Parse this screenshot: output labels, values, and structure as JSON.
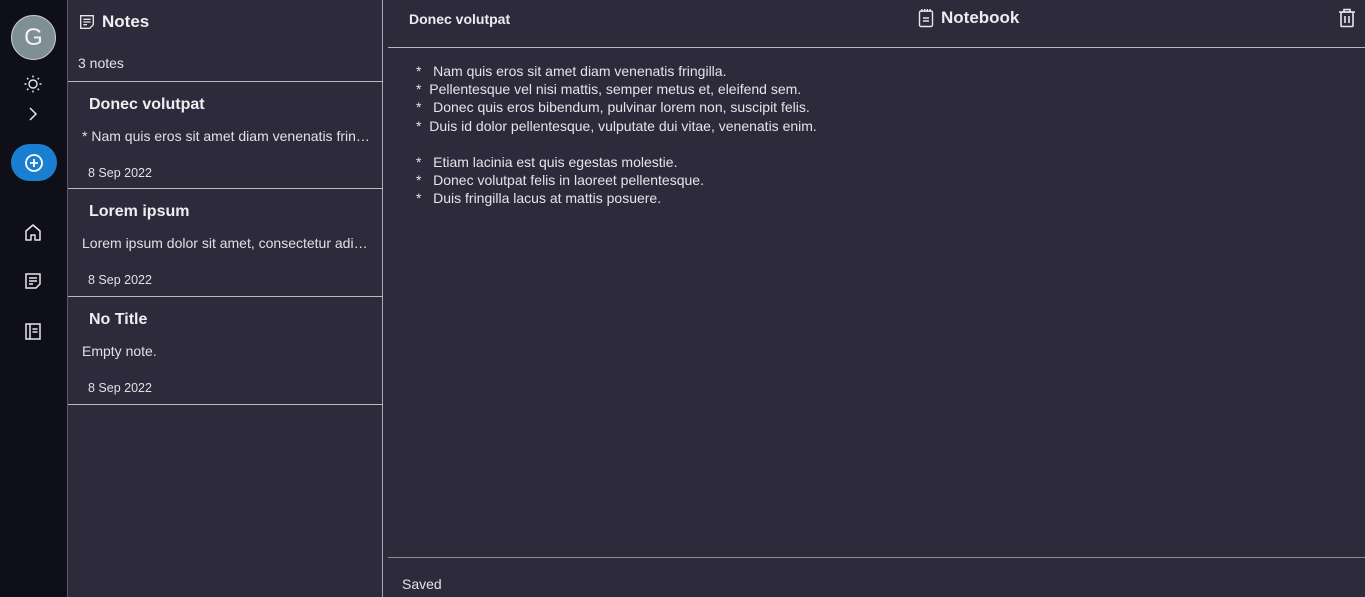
{
  "rail": {
    "avatar_letter": "G",
    "icons": [
      "sun-icon",
      "chevron-right-icon",
      "add-circle-icon",
      "home-icon",
      "notes-icon",
      "notebook-icon"
    ]
  },
  "list": {
    "title": "Notes",
    "count": "3 notes",
    "notes": [
      {
        "title": "Donec volutpat",
        "preview": "* Nam quis eros sit amet diam venenatis fringilla.",
        "date": "8 Sep 2022"
      },
      {
        "title": "Lorem ipsum",
        "preview": "Lorem ipsum dolor sit amet, consectetur adipiscing elit.",
        "date": "8 Sep 2022"
      },
      {
        "title": "No Title",
        "preview": "Empty note.",
        "date": "8 Sep 2022"
      }
    ]
  },
  "editor": {
    "title": "Donec volutpat",
    "notebook": "Notebook",
    "content": "*   Nam quis eros sit amet diam venenatis fringilla.\n*  Pellentesque vel nisi mattis, semper metus et, eleifend sem.\n*   Donec quis eros bibendum, pulvinar lorem non, suscipit felis.\n*  Duis id dolor pellentesque, vulputate dui vitae, venenatis enim.\n\n*   Etiam lacinia est quis egestas molestie.\n*   Donec volutpat felis in laoreet pellentesque.\n*   Duis fringilla lacus at mattis posuere.",
    "status": "Saved"
  },
  "colors": {
    "rail_bg": "#0f0f1a",
    "panel_bg": "#2d2b3b",
    "accent": "#1a7fd0",
    "avatar": "#7e8f95"
  }
}
